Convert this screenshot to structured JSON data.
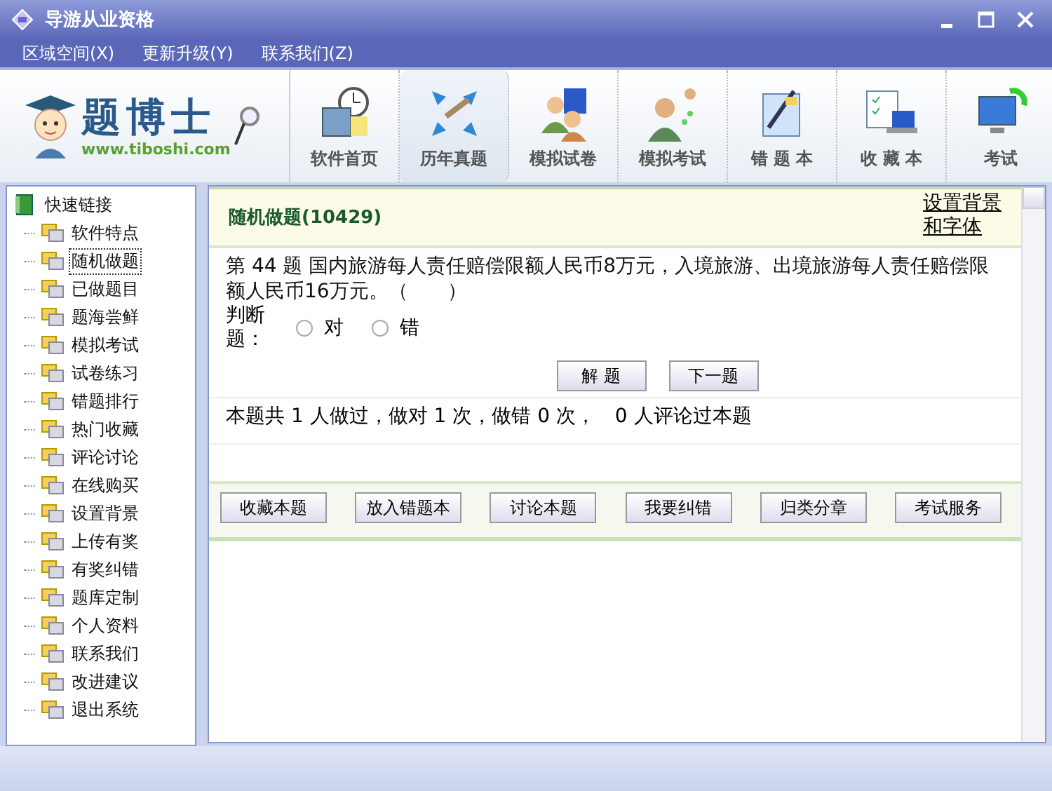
{
  "window": {
    "title": "导游从业资格"
  },
  "menu": [
    {
      "label": "区域空间(X)"
    },
    {
      "label": "更新升级(Y)"
    },
    {
      "label": "联系我们(Z)"
    }
  ],
  "logo": {
    "name": "题博士",
    "url": "www.tiboshi.com"
  },
  "toolbar": [
    {
      "label": "软件首页",
      "selected": false
    },
    {
      "label": "历年真题",
      "selected": true
    },
    {
      "label": "模拟试卷",
      "selected": false
    },
    {
      "label": "模拟考试",
      "selected": false
    },
    {
      "label": "错 题 本",
      "selected": false
    },
    {
      "label": "收 藏 本",
      "selected": false
    },
    {
      "label": "考试",
      "selected": false
    }
  ],
  "sidebar": {
    "label": "快速链接",
    "children": [
      {
        "label": "软件特点",
        "selected": false
      },
      {
        "label": "随机做题",
        "selected": true
      },
      {
        "label": "已做题目",
        "selected": false
      },
      {
        "label": "题海尝鲜",
        "selected": false
      },
      {
        "label": "模拟考试",
        "selected": false
      },
      {
        "label": "试卷练习",
        "selected": false
      },
      {
        "label": "错题排行",
        "selected": false
      },
      {
        "label": "热门收藏",
        "selected": false
      },
      {
        "label": "评论讨论",
        "selected": false
      },
      {
        "label": "在线购买",
        "selected": false
      },
      {
        "label": "设置背景",
        "selected": false
      },
      {
        "label": "上传有奖",
        "selected": false
      },
      {
        "label": "有奖纠错",
        "selected": false
      },
      {
        "label": "题库定制",
        "selected": false
      },
      {
        "label": "个人资料",
        "selected": false
      },
      {
        "label": "联系我们",
        "selected": false
      },
      {
        "label": "改进建议",
        "selected": false
      },
      {
        "label": "退出系统",
        "selected": false
      }
    ]
  },
  "panel": {
    "title": "随机做题(10429)",
    "settings_link": "设置背景和字体",
    "question": "第 44 题 国内旅游每人责任赔偿限额人民币8万元，入境旅游、出境旅游每人责任赔偿限额人民币16万元。（　　）",
    "type_label": "判断题：",
    "options": [
      {
        "label": "对",
        "checked": false
      },
      {
        "label": "错",
        "checked": false
      }
    ],
    "actions": [
      "解 题",
      "下一题"
    ],
    "stats": "本题共 1 人做过，做对 1 次，做错 0 次，　0 人评论过本题",
    "buttons": [
      "收藏本题",
      "放入错题本",
      "讨论本题",
      "我要纠错",
      "归类分章",
      "考试服务"
    ]
  }
}
